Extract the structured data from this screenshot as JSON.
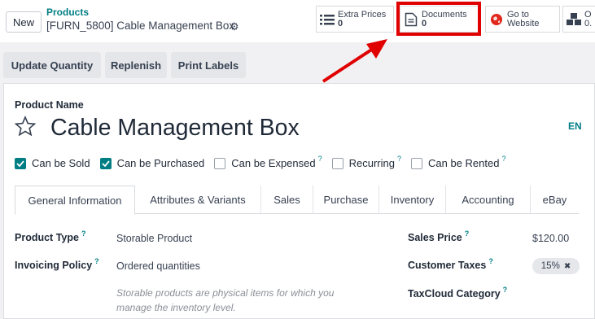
{
  "header": {
    "new_label": "New",
    "breadcrumb_parent": "Products",
    "breadcrumb_current": "[FURN_5800] Cable Management Box"
  },
  "smart_buttons": {
    "extra_prices": {
      "label": "Extra Prices",
      "count": "0"
    },
    "documents": {
      "label": "Documents",
      "count": "0"
    },
    "website": {
      "label_line1": "Go to",
      "label_line2": "Website"
    },
    "partial": {
      "label_line1": "O",
      "label_line2": "0."
    }
  },
  "actions": {
    "update_quantity": "Update Quantity",
    "replenish": "Replenish",
    "print_labels": "Print Labels"
  },
  "product": {
    "name_label": "Product Name",
    "name_value": "Cable Management Box",
    "lang": "EN"
  },
  "checkboxes": [
    {
      "label": "Can be Sold",
      "checked": true,
      "help": ""
    },
    {
      "label": "Can be Purchased",
      "checked": true,
      "help": ""
    },
    {
      "label": "Can be Expensed",
      "checked": false,
      "help": "?"
    },
    {
      "label": "Recurring",
      "checked": false,
      "help": "?"
    },
    {
      "label": "Can be Rented",
      "checked": false,
      "help": "?"
    }
  ],
  "tabs": [
    "General Information",
    "Attributes & Variants",
    "Sales",
    "Purchase",
    "Inventory",
    "Accounting",
    "eBay"
  ],
  "fields": {
    "product_type_label": "Product Type",
    "product_type_value": "Storable Product",
    "invoicing_policy_label": "Invoicing Policy",
    "invoicing_policy_value": "Ordered quantities",
    "help_text_line1": "Storable products are physical items for which you",
    "help_text_line2": "manage the inventory level.",
    "sales_price_label": "Sales Price",
    "sales_price_value": "$120.00",
    "customer_taxes_label": "Customer Taxes",
    "customer_taxes_value": "15%",
    "taxcloud_label": "TaxCloud Category",
    "help_mark": "?"
  },
  "colors": {
    "accent": "#017e84",
    "highlight": "#e00000"
  }
}
